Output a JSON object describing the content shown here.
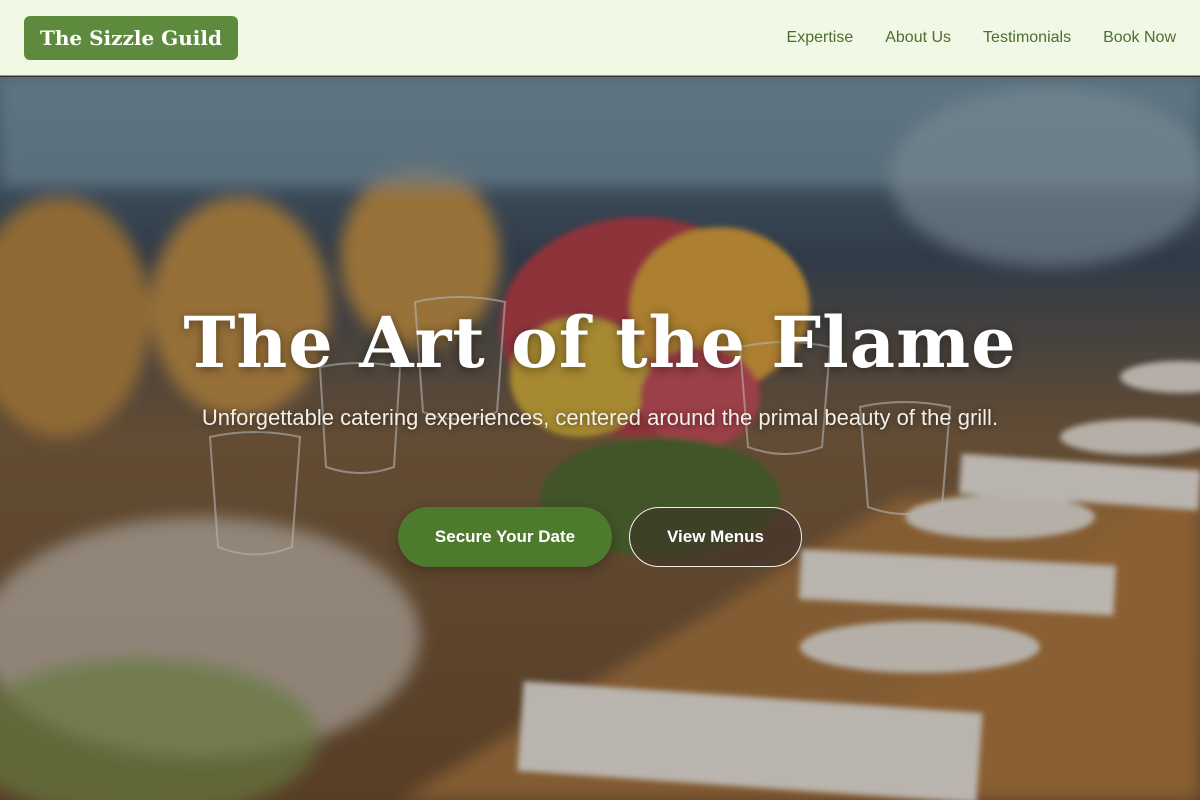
{
  "header": {
    "logo": "The Sizzle Guild",
    "nav": [
      {
        "label": "Expertise"
      },
      {
        "label": "About Us"
      },
      {
        "label": "Testimonials"
      },
      {
        "label": "Book Now"
      }
    ]
  },
  "hero": {
    "title": "The Art of the Flame",
    "subtitle": "Unforgettable catering experiences, centered around the primal beauty of the grill.",
    "primary_button": "Secure Your Date",
    "secondary_button": "View Menus",
    "background": "blurred banquet table with flower centerpiece, wine glasses and plates"
  },
  "colors": {
    "header_bg": "#f1f8e6",
    "brand_green": "#5e8a3e",
    "nav_text": "#4d6e2f",
    "button_green": "#4e7a2e"
  }
}
